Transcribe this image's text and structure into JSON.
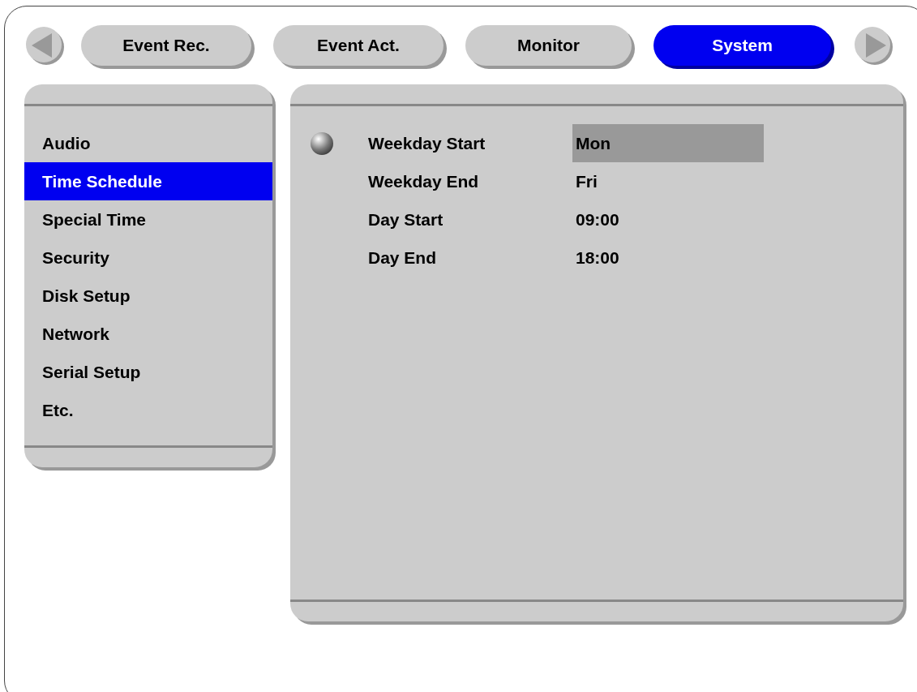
{
  "tabs": [
    {
      "label": "Event Rec.",
      "selected": false
    },
    {
      "label": "Event Act.",
      "selected": false
    },
    {
      "label": "Monitor",
      "selected": false
    },
    {
      "label": "System",
      "selected": true
    }
  ],
  "sidebar": {
    "items": [
      {
        "label": "Audio",
        "selected": false
      },
      {
        "label": "Time Schedule",
        "selected": true
      },
      {
        "label": "Special Time",
        "selected": false
      },
      {
        "label": "Security",
        "selected": false
      },
      {
        "label": "Disk Setup",
        "selected": false
      },
      {
        "label": "Network",
        "selected": false
      },
      {
        "label": "Serial Setup",
        "selected": false
      },
      {
        "label": "Etc.",
        "selected": false
      }
    ]
  },
  "settings": [
    {
      "label": "Weekday Start",
      "value": "Mon",
      "selected": true
    },
    {
      "label": "Weekday End",
      "value": "Fri",
      "selected": false
    },
    {
      "label": "Day Start",
      "value": "09:00",
      "selected": false
    },
    {
      "label": "Day End",
      "value": "18:00",
      "selected": false
    }
  ]
}
